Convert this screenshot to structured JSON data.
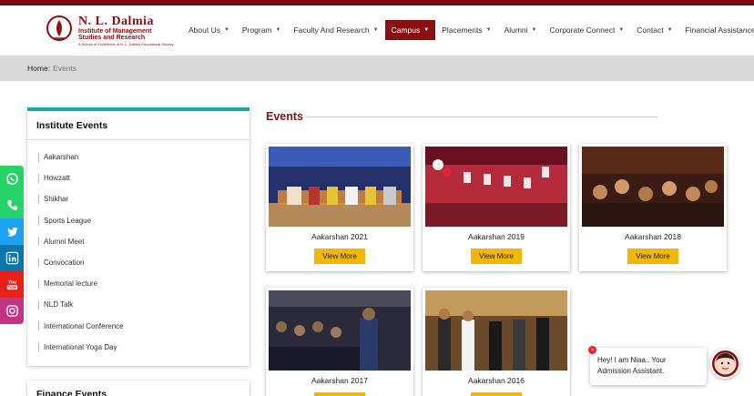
{
  "header": {
    "logo": {
      "name": "N. L. Dalmia",
      "line1": "Institute of Management",
      "line2": "Studies and Research",
      "line3": "A School of Excellence of N. L. Dalmia Educational Society"
    },
    "nav": [
      {
        "label": "About Us",
        "caret": true,
        "active": false
      },
      {
        "label": "Program",
        "caret": true,
        "active": false
      },
      {
        "label": "Faculty And Research",
        "caret": true,
        "active": false
      },
      {
        "label": "Campus",
        "caret": true,
        "active": true
      },
      {
        "label": "Placements",
        "caret": true,
        "active": false
      },
      {
        "label": "Alumni",
        "caret": true,
        "active": false
      },
      {
        "label": "Corporate Connect",
        "caret": true,
        "active": false
      },
      {
        "label": "Contact",
        "caret": true,
        "active": false
      },
      {
        "label": "Financial Assistance",
        "caret": false,
        "active": false
      }
    ],
    "caret_glyph": "▼"
  },
  "breadcrumb": {
    "home": "Home",
    "separator": ":",
    "current": "Events"
  },
  "sidebar": {
    "title": "Institute Events",
    "items": [
      "Aakarshan",
      "Howzatt",
      "Shikhar",
      "Sports League",
      "Alumni Meet",
      "Convocation",
      "Memorial lecture",
      "NLD Talk",
      "International Conference",
      "International Yoga Day"
    ],
    "next_title": "Finance Events"
  },
  "social": [
    {
      "icon": "whatsapp-icon",
      "color": "#25d366"
    },
    {
      "icon": "phone-icon",
      "color": "#25d366"
    },
    {
      "icon": "twitter-icon",
      "color": "#1da1f2"
    },
    {
      "icon": "linkedin-icon",
      "color": "#0e76a8"
    },
    {
      "icon": "youtube-icon",
      "color": "#e62117"
    },
    {
      "icon": "instagram-icon",
      "color": "#c13584"
    }
  ],
  "events": {
    "title": "Events",
    "button_label": "View More",
    "cards": [
      {
        "name": "Aakarshan 2021"
      },
      {
        "name": "Aakarshan 2019"
      },
      {
        "name": "Aakarshan 2018"
      },
      {
        "name": "Aakarshan 2017"
      },
      {
        "name": "Aakarshan 2016"
      }
    ]
  },
  "chat": {
    "close_glyph": "×",
    "line1": "Hey! I am Niaa.. Your",
    "line2": "Admission Assistant."
  },
  "colors": {
    "brand": "#8a0f13",
    "accent_teal": "#1aa9a0",
    "button_yellow": "#f2b705"
  }
}
